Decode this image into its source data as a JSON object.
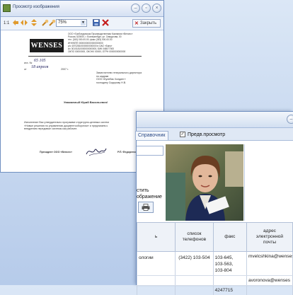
{
  "viewer": {
    "title": "Просмотр изображения",
    "zoom": "75%",
    "close_label": "Закрыть",
    "toolbar_labels": [
      "1:1"
    ],
    "document": {
      "logo": "WENSES",
      "sender_lines": [
        "ООО «Грибоедовская Производственная Компания «Венсес»",
        "Россия, 620000, г. Екатеринбург, ул. Свердлова, 00",
        "тел. (343) 000-00-00, факс (343) 000-00-00",
        "ИНН/КПП 0000000000/000000000",
        "р/с 40702810000000000000 в ОАО «Банк»",
        "к/с 30101810000000000000, БИК 046577000",
        "ОКПО 00000000, ОКОНХ 00000, ОГРН 0000000000000"
      ],
      "ref_prefix": "исх. №",
      "ref_value": "65 105",
      "date_prefix": "от",
      "date_value": "18 апреля",
      "year": "2007 г.",
      "recipient_lines": [
        "Заместителю генерального директора",
        "по кадрам",
        "ООО «Кулебак Холдинг»",
        "господину Сидорову Н.В."
      ],
      "salutation": "Уважаемый Юрий Васильевич!",
      "body_lines": [
        "Исполнение Вас утвердительно программе структурно-целевых систем",
        "«Новые решения по управлению документооборотом» и предлагаем к",
        "внедрению передовые системы как рабочее."
      ],
      "signature_role": "Президент ООО «Венсес»",
      "signature_name": "Р.П. Федоренко"
    }
  },
  "contacts": {
    "tabs": [
      "Справочник"
    ],
    "preview_checkbox_label": "Предв.просмотр",
    "preview_checked": true,
    "side_label_line1": "стить",
    "side_label_line2": "ображение",
    "columns": [
      "ь",
      "список\nтелефонов",
      "факс",
      "адрес\nэлектронной\nпочты"
    ],
    "rows": [
      {
        "name": "ологии",
        "phones": "(3422) 103-504",
        "fax": "103-645,\n103-563,\n103-804",
        "email": "mvelcshkina@wenses"
      },
      {
        "name": "",
        "phones": "",
        "fax": "",
        "email": "avoronova@wenses"
      },
      {
        "name": "",
        "phones": "",
        "fax": "4247715",
        "email": ""
      }
    ]
  }
}
